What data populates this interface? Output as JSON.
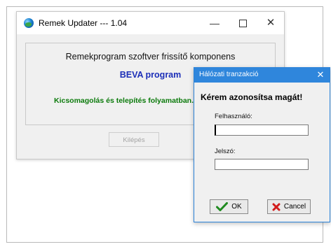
{
  "main_window": {
    "title": "Remek Updater --- 1.04",
    "headline": "Remekprogram szoftver frissítő komponens",
    "program": "BEVA program",
    "status": "Kicsomagolás és telepítés folyamatban...",
    "exit_label": "Kilépés",
    "controls": {
      "minimize": "—",
      "close": "✕"
    }
  },
  "login_dialog": {
    "title": "Hálózati tranzakció",
    "close_glyph": "✕",
    "heading": "Kérem azonosítsa magát!",
    "username_label": "Felhasználó:",
    "username_value": "",
    "password_label": "Jelszó:",
    "password_value": "",
    "ok_label": "OK",
    "cancel_label": "Cancel"
  },
  "colors": {
    "program_text": "#1c2fb8",
    "status_text": "#0b7a0b",
    "dialog_titlebar": "#2f86dc",
    "ok_check": "#1f8a1f",
    "cancel_x": "#d21c1c"
  },
  "icons": {
    "app": "updater-globe-icon",
    "ok": "check-icon",
    "cancel": "x-icon"
  }
}
